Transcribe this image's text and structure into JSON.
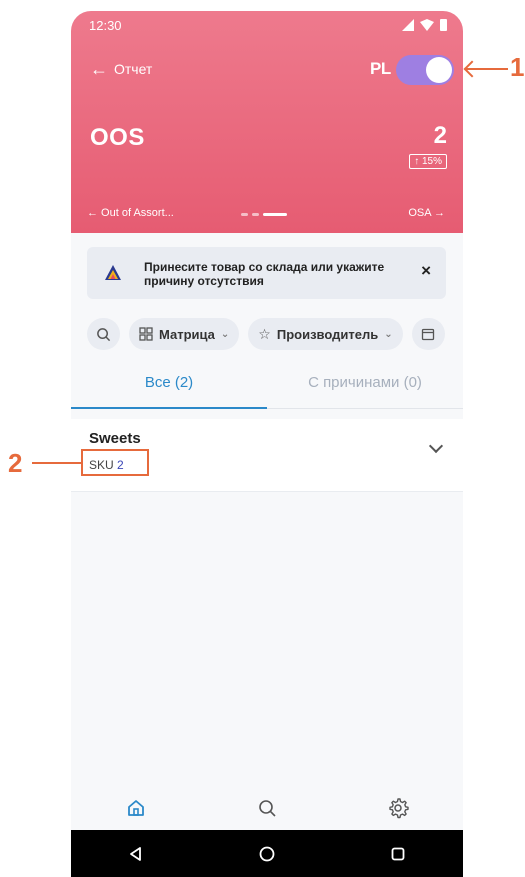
{
  "status_bar": {
    "time": "12:30"
  },
  "header": {
    "back_label": "Отчет",
    "toggle_label": "PL",
    "metric_title": "OOS",
    "metric_value": "2",
    "metric_change": "↑ 15%",
    "nav_prev": "← Out of Assort...",
    "nav_next": "OSA →",
    "accent_color": "#e65c72",
    "toggle_color": "#9e7fe2"
  },
  "banner": {
    "text": "Принесите товар со склада или укажите причину отсутствия",
    "close": "×"
  },
  "filters": {
    "items": [
      {
        "label": "Матрица",
        "icon": "grid-icon"
      },
      {
        "label": "Производитель",
        "icon": "star-icon"
      }
    ]
  },
  "tabs": {
    "all": "Все (2)",
    "with_reasons": "С причинами (0)"
  },
  "list": {
    "items": [
      {
        "title": "Sweets",
        "sku_label": "SKU",
        "sku_count": "2"
      }
    ]
  },
  "annotations": {
    "one": "1",
    "two": "2"
  }
}
